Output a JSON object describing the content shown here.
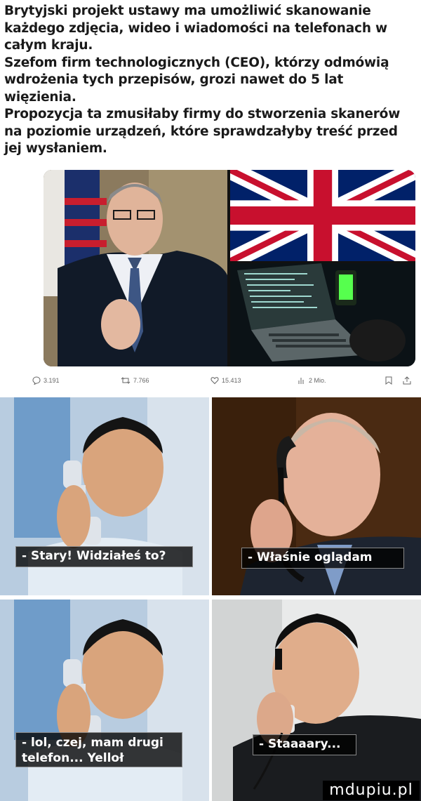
{
  "post": {
    "paragraph1": "Brytyjski projekt ustawy ma umożliwić skanowanie każdego zdjęcia, wideo i wiadomości na telefonach w całym kraju.",
    "paragraph2": "Szefom firm technologicznych (CEO), którzy odmówią wdrożenia tych przepisów, grozi nawet do 5 lat więzienia.",
    "paragraph3": "Propozycja ta zmusiłaby firmy do stworzenia skanerów na poziomie urządzeń, które sprawdzałyby treść przed jej wysłaniem."
  },
  "actions": {
    "replies": "3.191",
    "reposts": "7.766",
    "likes": "15.413",
    "views": "2 Mio."
  },
  "meme": {
    "caption1": "- Stary! Widziałeś to?",
    "caption2": "- Właśnie oglądam",
    "caption3_line1": "- lol, czej, mam drugi",
    "caption3_line2": "telefon... Yelloł",
    "caption4": "- Staaaary..."
  },
  "watermark": "mdupiu.pl"
}
